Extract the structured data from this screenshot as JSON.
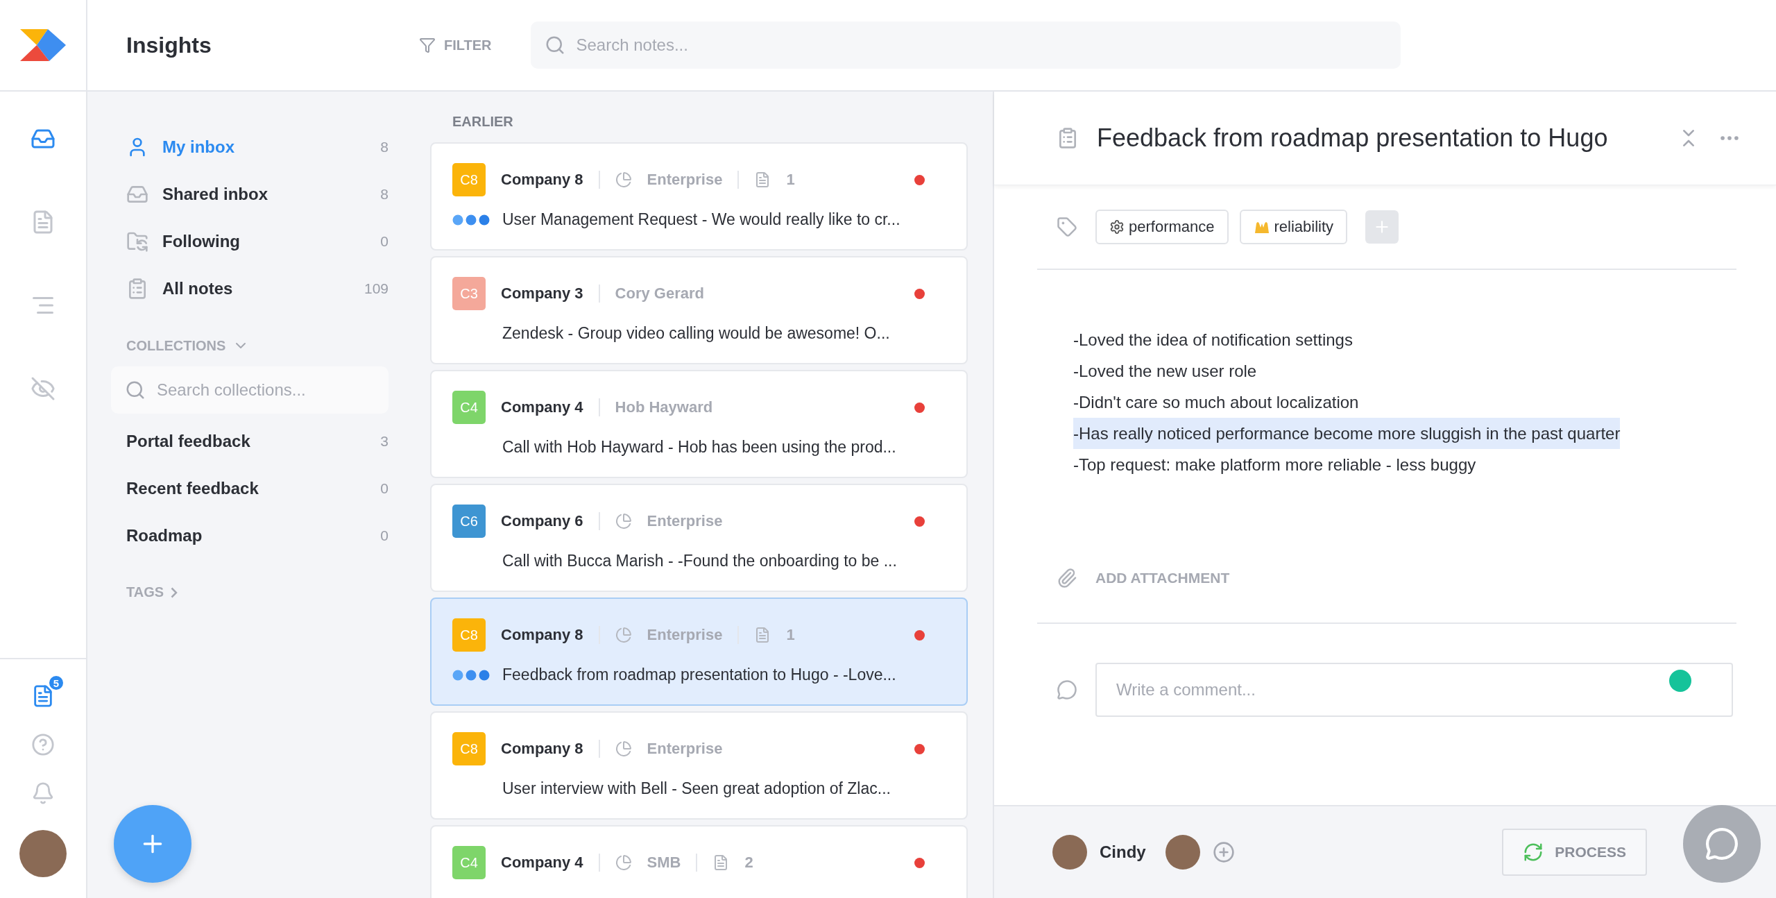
{
  "header": {
    "title": "Insights",
    "filter_label": "FILTER",
    "search": {
      "placeholder": "Search notes..."
    }
  },
  "rail": {
    "items": [
      {
        "kind": "inbox",
        "selected": true
      },
      {
        "kind": "notes",
        "selected": false
      },
      {
        "kind": "roadmap",
        "selected": false
      },
      {
        "kind": "hidden",
        "selected": false
      }
    ],
    "notes_badge": "5"
  },
  "sidebar": {
    "inbox_items": [
      {
        "kind": "person",
        "label": "My inbox",
        "count": "8",
        "selected": true
      },
      {
        "kind": "tray",
        "label": "Shared inbox",
        "count": "8",
        "selected": false
      },
      {
        "kind": "folder",
        "label": "Following",
        "count": "0",
        "selected": false
      },
      {
        "kind": "clipboard",
        "label": "All notes",
        "count": "109",
        "selected": false
      }
    ],
    "collections_heading": "COLLECTIONS",
    "collections_search": {
      "placeholder": "Search collections..."
    },
    "collections": [
      {
        "label": "Portal feedback",
        "count": "3"
      },
      {
        "label": "Recent feedback",
        "count": "0"
      },
      {
        "label": "Roadmap",
        "count": "0"
      }
    ],
    "tags_heading": "TAGS"
  },
  "list": {
    "section": "EARLIER",
    "cards": [
      {
        "badge": "C8",
        "color": "#fbb40a",
        "company": "Company 8",
        "kind": "segment",
        "meta": "Enterprise",
        "notes": "1",
        "dots": true,
        "unread": true,
        "preview": "User Management Request - We would really like to cr...",
        "selected": false
      },
      {
        "badge": "C3",
        "color": "#f4a89a",
        "company": "Company 3",
        "kind": "person",
        "meta": "Cory Gerard",
        "dots": false,
        "unread": true,
        "preview": "Zendesk - Group video calling would be awesome! O...",
        "selected": false
      },
      {
        "badge": "C4",
        "color": "#7ed56a",
        "company": "Company 4",
        "kind": "person",
        "meta": "Hob Hayward",
        "dots": false,
        "unread": true,
        "preview": "Call with Hob Hayward - Hob has been using the prod...",
        "selected": false
      },
      {
        "badge": "C6",
        "color": "#3e95d2",
        "company": "Company 6",
        "kind": "segment",
        "meta": "Enterprise",
        "dots": false,
        "unread": true,
        "preview": "Call with Bucca Marish - -Found the onboarding to be ...",
        "selected": false
      },
      {
        "badge": "C8",
        "color": "#fbb40a",
        "company": "Company 8",
        "kind": "segment",
        "meta": "Enterprise",
        "notes": "1",
        "dots": true,
        "unread": true,
        "preview": "Feedback from roadmap presentation to Hugo - -Love...",
        "selected": true
      },
      {
        "badge": "C8",
        "color": "#fbb40a",
        "company": "Company 8",
        "kind": "segment",
        "meta": "Enterprise",
        "dots": false,
        "unread": true,
        "preview": "User interview with Bell - Seen great adoption of Zlac...",
        "selected": false
      },
      {
        "badge": "C4",
        "color": "#7ed56a",
        "company": "Company 4",
        "kind": "segment",
        "meta": "SMB",
        "notes": "2",
        "unread": true,
        "selected": false
      }
    ]
  },
  "detail": {
    "title": "Feedback from roadmap presentation to Hugo",
    "tags": [
      {
        "kind": "gear",
        "label": "performance"
      },
      {
        "kind": "hands",
        "label": "reliability"
      }
    ],
    "lines": [
      {
        "text": "-Loved the idea of notification settings",
        "selected": false
      },
      {
        "text": "-Loved the new user role",
        "selected": false
      },
      {
        "text": "-Didn't care so much about localization",
        "selected": false
      },
      {
        "text": "-Has really noticed performance become more sluggish in the past quarter",
        "selected": true
      },
      {
        "text": "-Top request: make platform more reliable - less buggy",
        "selected": false
      }
    ],
    "attachment_label": "ADD ATTACHMENT",
    "comment": {
      "placeholder": "Write a comment..."
    },
    "footer": {
      "user": "Cindy",
      "process_label": "PROCESS"
    }
  }
}
